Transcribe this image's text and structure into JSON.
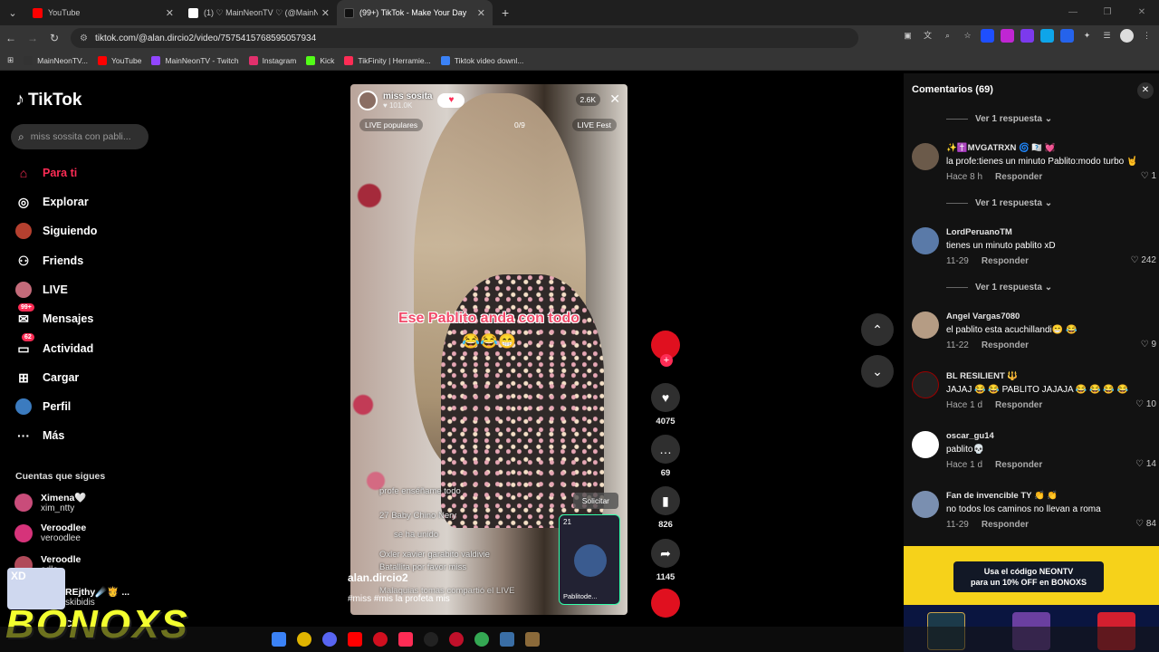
{
  "browser": {
    "tabs": [
      {
        "title": "YouTube",
        "active": false,
        "color": "#ff0000"
      },
      {
        "title": "(1) ♡ MainNeonTV ♡ (@MainN",
        "active": false,
        "color": "#ffffff"
      },
      {
        "title": "(99+) TikTok - Make Your Day",
        "active": true,
        "color": "#000000"
      }
    ],
    "new_tab": "+",
    "url": "tiktok.com/@alan.dircio2/video/7575415768595057934",
    "bookmarks": [
      {
        "label": "MainNeonTV...",
        "color": "#9146ff"
      },
      {
        "label": "YouTube",
        "color": "#ff0000"
      },
      {
        "label": "MainNeonTV - Twitch",
        "color": "#9146ff"
      },
      {
        "label": "Instagram",
        "color": "#e1306c"
      },
      {
        "label": "Kick",
        "color": "#53fc18"
      },
      {
        "label": "TikFinity | Herramie...",
        "color": "#fe2c55"
      },
      {
        "label": "Tiktok video downl...",
        "color": "#3b82f6"
      }
    ]
  },
  "sidebar": {
    "logo": "TikTok",
    "search_placeholder": "miss sossita con pabli...",
    "nav": [
      {
        "label": "Para ti",
        "icon": "home-icon",
        "glyph": "⌂",
        "active": true
      },
      {
        "label": "Explorar",
        "icon": "compass-icon",
        "glyph": "◎"
      },
      {
        "label": "Siguiendo",
        "icon": "following-icon",
        "glyph": "●"
      },
      {
        "label": "Friends",
        "icon": "friends-icon",
        "glyph": "👥"
      },
      {
        "label": "LIVE",
        "icon": "live-icon",
        "glyph": "●"
      },
      {
        "label": "Mensajes",
        "icon": "messages-icon",
        "glyph": "✉",
        "badge": "99+"
      },
      {
        "label": "Actividad",
        "icon": "activity-icon",
        "glyph": "▭",
        "badge": "62"
      },
      {
        "label": "Cargar",
        "icon": "upload-icon",
        "glyph": "⊞"
      },
      {
        "label": "Perfil",
        "icon": "profile-icon",
        "glyph": "●"
      },
      {
        "label": "Más",
        "icon": "more-icon",
        "glyph": "···"
      }
    ],
    "following_header": "Cuentas que sigues",
    "following": [
      {
        "name": "Ximena🤍",
        "handle": "xim_ntty",
        "color": "#c94c7a"
      },
      {
        "name": "Veroodlee",
        "handle": "veroodlee",
        "color": "#d6337a"
      },
      {
        "name": "Veroodle",
        "handle": "odle",
        "color": "#b04a5a"
      },
      {
        "name": "REjthy☄️🫅 ...",
        "handle": "skibidis",
        "color": "#4a4a4a"
      },
      {
        "name": "CY",
        "handle": "",
        "color": "#333333"
      }
    ]
  },
  "video": {
    "live_user": "miss sosita",
    "live_likes": "♥ 101.0K",
    "viewers": "2.6K",
    "pill_left": "LIVE populares",
    "pill_mid": "0/9",
    "pill_right": "LIVE Fest",
    "caption": "Ese Pablito anda con todo",
    "caption_emoji": "😂😂😁",
    "chat": [
      "profe enséñame todo",
      "27 Baby   Chino Nery",
      "se ha unido",
      "Oxler xavier garabito valdivie",
      "Batallita por favor miss",
      "Malaquias  tomas compartió el LIVE"
    ],
    "solicitar": "Solicitar",
    "pip_count": "21",
    "pip_label": "Pablitode...",
    "author": "alan.dircio2",
    "description": "#miss #mis la profeta mis"
  },
  "actions": {
    "likes": "4075",
    "comments": "69",
    "saves": "826",
    "shares": "1145"
  },
  "comments": {
    "header": "Comentarios (69)",
    "view_reply": "Ver 1 respuesta",
    "reply_label": "Responder",
    "items": [
      {
        "user": "✨✝️MVGATRXN 🌀 🇽🇽 💓",
        "text": "la profe:tienes un minuto Pablito:modo turbo 🤘",
        "time": "Hace 8 h",
        "likes": "1",
        "color": "#6b5a4a"
      },
      {
        "user": "LordPeruanoTM",
        "text": "tienes un minuto pablito xD",
        "time": "11-29",
        "likes": "242",
        "color": "#5a7aa8"
      },
      {
        "user": "Angel Vargas7080",
        "text": "el pablito esta acuchillandi😁 😂",
        "time": "11-22",
        "likes": "9",
        "color": "#b59c84"
      },
      {
        "user": "BL RESILIENT 🔱",
        "text": "JAJAJ 😂 😂 PABLITO JAJAJA 😂 😂 😂 😂",
        "time": "Hace 1 d",
        "likes": "10",
        "color": "#222222"
      },
      {
        "user": "oscar_gu14",
        "text": "pablito💀",
        "time": "Hace 1 d",
        "likes": "14",
        "color": "#ffffff"
      },
      {
        "user": "Fan de invencible TY 👏 👏",
        "text": "no todos los caminos no llevan a roma",
        "time": "11-29",
        "likes": "84",
        "color": "#7a8fb0"
      }
    ]
  },
  "ad": {
    "line1": "Usa el código NEONTV",
    "line2": "para un 10% OFF en BONOXS"
  },
  "overlay": {
    "brand": "BONOXS",
    "tag": "XD"
  }
}
